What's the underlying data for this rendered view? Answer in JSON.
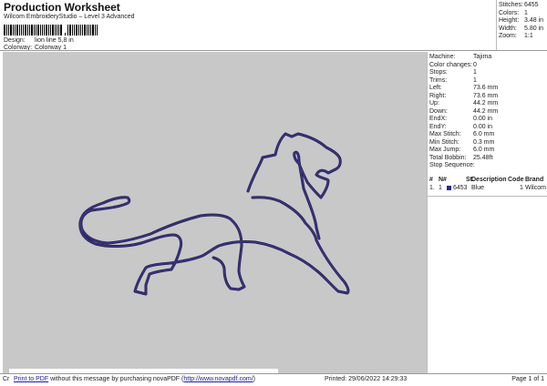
{
  "header": {
    "title": "Production Worksheet",
    "subtitle": "Wilcom EmbroideryStudio – Level 3 Advanced",
    "design_label": "Design:",
    "design_value": "lion line 5,8 in",
    "colorway_label": "Colorway:",
    "colorway_value": "Colorway 1"
  },
  "summary": [
    {
      "label": "Stitches:",
      "value": "6455"
    },
    {
      "label": "Colors:",
      "value": "1"
    },
    {
      "label": "Height:",
      "value": "3.48 in"
    },
    {
      "label": "Width:",
      "value": "5.80 in"
    },
    {
      "label": "Zoom:",
      "value": "1:1"
    }
  ],
  "details": [
    {
      "label": "Machine:",
      "value": "Tajima"
    },
    {
      "label": "Color changes:",
      "value": "0"
    },
    {
      "label": "Stops:",
      "value": "1"
    },
    {
      "label": "Trims:",
      "value": "1"
    },
    {
      "label": "Left:",
      "value": "73.6 mm"
    },
    {
      "label": "Right:",
      "value": "73.6 mm"
    },
    {
      "label": "Up:",
      "value": "44.2 mm"
    },
    {
      "label": "Down:",
      "value": "44.2 mm"
    },
    {
      "label": "EndX:",
      "value": "0.00 in"
    },
    {
      "label": "EndY:",
      "value": "0.00 in"
    },
    {
      "label": "Max Stitch:",
      "value": "6.0 mm"
    },
    {
      "label": "Min Stitch:",
      "value": "0.3 mm"
    },
    {
      "label": "Max Jump:",
      "value": "6.0 mm"
    },
    {
      "label": "Total Bobbin:",
      "value": "25.48ft"
    }
  ],
  "stop_sequence": {
    "title": "Stop Sequence:",
    "headers": [
      "#",
      "N#",
      "St.",
      "Description",
      "Code",
      "Brand"
    ],
    "rows": [
      {
        "num": "1.",
        "n": "1",
        "st": "6453",
        "description": "Blue",
        "code": "1",
        "brand": "Wilcom",
        "color": "#2a2a8c"
      }
    ]
  },
  "design_color": "#3b3588",
  "footer": {
    "prefix": "Cr",
    "link1": "Print to PDF",
    "message": " without this message by purchasing novaPDF (",
    "link2": "http://www.novapdf.com/",
    "suffix": ")",
    "printed": "Printed: 29/06/2022 14:29:33",
    "page": "Page 1 of 1"
  }
}
